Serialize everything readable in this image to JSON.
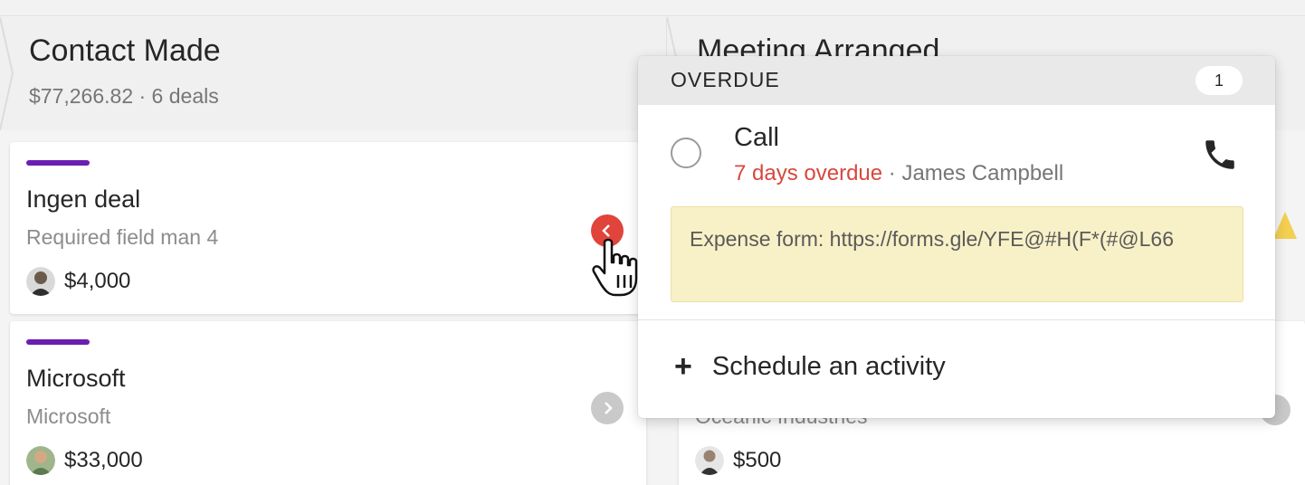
{
  "stages": {
    "contact_made": {
      "title": "Contact Made",
      "summary": "$77,266.82 · 6 deals"
    },
    "meeting_arranged": {
      "title": "Meeting Arranged"
    }
  },
  "deals": [
    {
      "title": "Ingen deal",
      "subtitle": "Required field man 4",
      "value": "$4,000",
      "status": "overdue",
      "status_color": "#e0443a",
      "bar_color": "#6b1fb1"
    },
    {
      "title": "Microsoft",
      "subtitle": "Microsoft",
      "value": "$33,000",
      "status": "none",
      "status_color": "#c9c9c9",
      "bar_color": "#6b1fb1"
    }
  ],
  "right_column": {
    "partial_subtitle": "Oceanic Industries",
    "value": "$500"
  },
  "popover": {
    "header_label": "OVERDUE",
    "header_count": "1",
    "activity": {
      "type": "Call",
      "overdue_text": "7 days overdue",
      "separator": " · ",
      "person": "James Campbell",
      "icon": "phone-icon",
      "note": "Expense form: https://forms.gle/YFE@#H(F*(#@L66"
    },
    "schedule_label": "Schedule an activity"
  },
  "colors": {
    "overdue_red": "#d8473e",
    "deal_bar_purple": "#6b1fb1",
    "note_bg": "#f8f1c7"
  }
}
